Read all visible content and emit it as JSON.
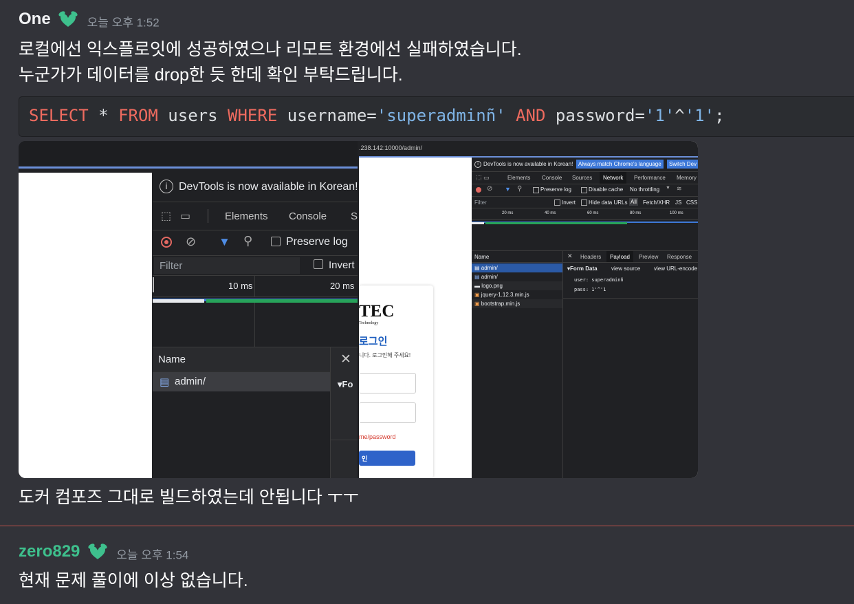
{
  "message1": {
    "author": "One",
    "timestamp": "오늘 오후 1:52",
    "lines": [
      "로컬에선 익스플로잇에 성공하였으나 리모트 환경에선 실패하였습니다.",
      "누군가가 데이터를 drop한 듯 한데 확인 부탁드립니다."
    ],
    "code": {
      "tokens": [
        {
          "t": "SELECT",
          "c": "kw"
        },
        {
          "t": " * ",
          "c": "op"
        },
        {
          "t": "FROM",
          "c": "kw"
        },
        {
          "t": " users ",
          "c": "op"
        },
        {
          "t": "WHERE",
          "c": "kw"
        },
        {
          "t": " username=",
          "c": "op"
        },
        {
          "t": "'superadminñ'",
          "c": "str"
        },
        {
          "t": " ",
          "c": "op"
        },
        {
          "t": "AND",
          "c": "kw"
        },
        {
          "t": " password=",
          "c": "op"
        },
        {
          "t": "'1'",
          "c": "str"
        },
        {
          "t": "^",
          "c": "op"
        },
        {
          "t": "'1'",
          "c": "str"
        },
        {
          "t": ";",
          "c": "op"
        }
      ]
    },
    "after_image": "도커 컴포즈 그대로 빌드하였는데 안됩니다 ㅜㅜ"
  },
  "message2": {
    "author": "zero829",
    "timestamp": "오늘 오후 1:54",
    "line": "현재 문제 풀이에 이상 없습니다."
  },
  "screenshot_left": {
    "notice": "DevTools is now available in Korean!",
    "tabs": [
      "Elements",
      "Console",
      "S"
    ],
    "preserve_log": "Preserve log",
    "filter_placeholder": "Filter",
    "invert": "Invert",
    "ticks": [
      "10 ms",
      "20 ms"
    ],
    "name_header": "Name",
    "request": "admin/",
    "form_label": "▾Fo"
  },
  "screenshot_right": {
    "url": ".238.142:10000/admin/",
    "notice": "DevTools is now available in Korean!",
    "match_btn": "Always match Chrome's language",
    "switch_btn": "Switch Dev",
    "tabs": [
      "Elements",
      "Console",
      "Sources",
      "Network",
      "Performance",
      "Memory"
    ],
    "toolbar": {
      "preserve": "Preserve log",
      "disable_cache": "Disable cache",
      "throttle": "No throttling"
    },
    "filter_row": {
      "placeholder": "Filter",
      "invert": "Invert",
      "hide_data": "Hide data URLs",
      "types": [
        "All",
        "Fetch/XHR",
        "JS",
        "CSS"
      ]
    },
    "ticks": [
      "20 ms",
      "40 ms",
      "60 ms",
      "80 ms",
      "100 ms"
    ],
    "name_header": "Name",
    "requests": [
      "admin/",
      "admin/",
      "logo.png",
      "jquery-1.12.3.min.js",
      "bootstrap.min.js"
    ],
    "detail_tabs": [
      "Headers",
      "Payload",
      "Preview",
      "Response"
    ],
    "form_data": "▾Form Data",
    "view_source": "view source",
    "view_url": "view URL-encode",
    "user_line": "user: superadminñ",
    "pass_line": "pass: 1'^'1",
    "login_logo": "TEC",
    "login_logo_sub": "Technology",
    "login_title": "로그인",
    "login_sub": "니다. 로그인해 주세요!",
    "error": "me/password",
    "login_btn": "인"
  },
  "colors": {
    "bg": "#323339",
    "code_bg": "#2b2d31",
    "keyword": "#ef6b5f",
    "string": "#7fb4e6",
    "green_name": "#3ec08d",
    "devtools_bg": "#202124",
    "devtools_blue": "#3d78d8"
  }
}
